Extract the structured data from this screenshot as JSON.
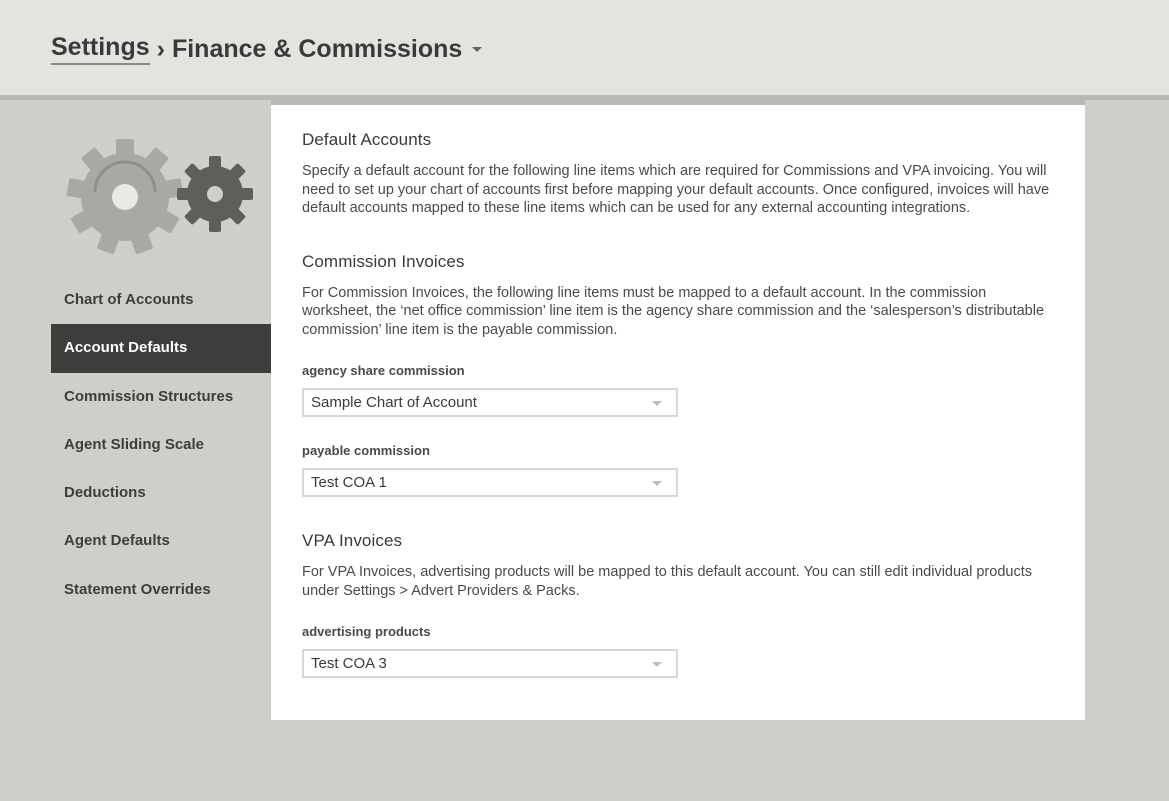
{
  "header": {
    "breadcrumb_root": "Settings",
    "separator": "›",
    "breadcrumb_current": "Finance & Commissions"
  },
  "sidebar": {
    "items": [
      {
        "label": "Chart of Accounts"
      },
      {
        "label": "Account Defaults",
        "active": true
      },
      {
        "label": "Commission Structures"
      },
      {
        "label": "Agent Sliding Scale"
      },
      {
        "label": "Deductions"
      },
      {
        "label": "Agent Defaults"
      },
      {
        "label": "Statement Overrides"
      }
    ],
    "icon": "gears-icon"
  },
  "main": {
    "default_accounts": {
      "title": "Default Accounts",
      "description": "Specify a default account for the following line items which are required for Commissions and VPA invoicing. You will need to set up your chart of accounts first before mapping your default accounts. Once configured, invoices will have default accounts mapped to these line items which can be used for any external accounting integrations."
    },
    "commission_invoices": {
      "title": "Commission Invoices",
      "description": "For Commission Invoices, the following line items must be mapped to a default account. In the commission worksheet, the ‘net office commission’ line item is the agency share commission and the ‘salesperson’s distributable commission’ line item is the payable commission.",
      "agency_share": {
        "label": "agency share commission",
        "value": "Sample Chart of Account"
      },
      "payable": {
        "label": "payable commission",
        "value": "Test COA 1"
      }
    },
    "vpa_invoices": {
      "title": "VPA Invoices",
      "description": "For VPA Invoices, advertising products will be mapped to this default account. You can still edit individual products under Settings > Advert Providers & Packs.",
      "advertising": {
        "label": "advertising products",
        "value": "Test COA 3"
      }
    }
  },
  "colors": {
    "background": "#cfcfc9",
    "topbar": "#e3e3df",
    "active_nav": "#3d3d3b",
    "panel": "#ffffff"
  }
}
